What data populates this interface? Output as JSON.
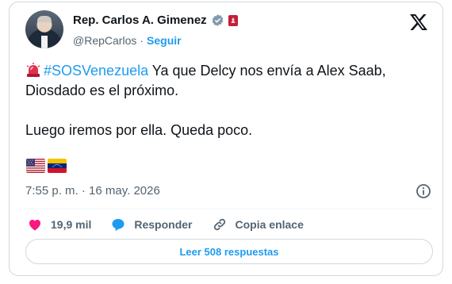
{
  "author": {
    "name": "Rep. Carlos A. Gimenez",
    "handle": "@RepCarlos",
    "separator": "·",
    "follow_label": "Seguir"
  },
  "tweet": {
    "hashtag": "#SOSVenezuela",
    "line1_rest": " Ya que Delcy nos envía a Alex Saab, Diosdado es el próximo.",
    "line2": "Luego iremos por ella. Queda poco.",
    "emoji_flags": [
      "us-flag",
      "venezuela-flag"
    ]
  },
  "timestamp": "7:55 p. m. · 16 may. 2026",
  "actions": {
    "likes": "19,9 mil",
    "reply_label": "Responder",
    "copy_label": "Copia enlace"
  },
  "read_replies_label": "Leer 508 respuestas",
  "colors": {
    "accent": "#1d9bf0",
    "like_pink": "#f91880",
    "text_primary": "#0f1419",
    "text_secondary": "#536471",
    "border": "#cfd9de"
  }
}
